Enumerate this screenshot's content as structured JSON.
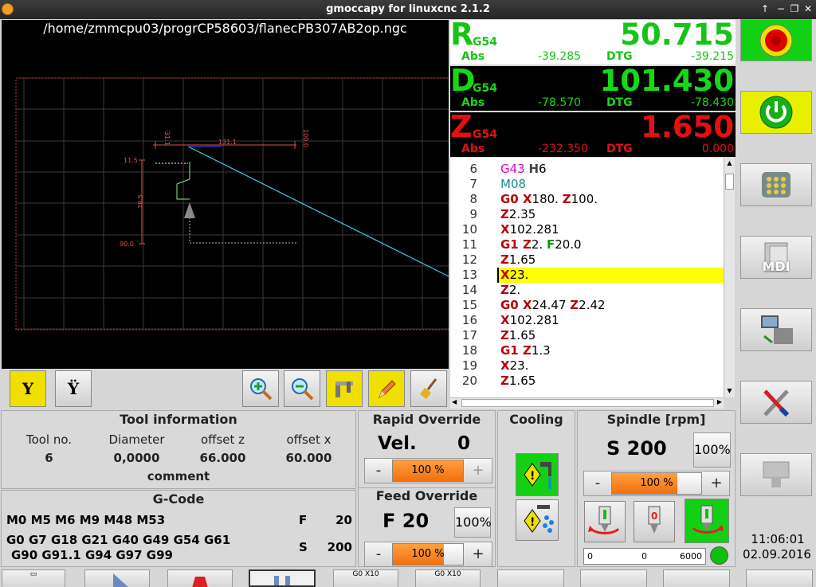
{
  "window": {
    "title": "gmoccapy for linuxcnc  2.1.2"
  },
  "preview": {
    "path": "/home/zmmcpu03/progrCP58603/flanecPB307AB2op.ngc"
  },
  "dro": [
    {
      "axis": "R",
      "system": "G54",
      "value": "50.715",
      "abs_label": "Abs",
      "abs": "-39.285",
      "dtg_label": "DTG",
      "dtg": "-39.215",
      "bg": "#ffffff",
      "fg": "#16c416"
    },
    {
      "axis": "D",
      "system": "G54",
      "value": "101.430",
      "abs_label": "Abs",
      "abs": "-78.570",
      "dtg_label": "DTG",
      "dtg": "-78.430",
      "bg": "#000000",
      "fg": "#16d816"
    },
    {
      "axis": "Z",
      "system": "G54",
      "value": "1.650",
      "abs_label": "Abs",
      "abs": "-232.350",
      "dtg_label": "DTG",
      "dtg": "0.000",
      "bg": "#000000",
      "fg": "#e41010"
    }
  ],
  "gcode": {
    "lines": [
      {
        "n": "6",
        "code": [
          [
            "g43",
            "G43 "
          ],
          [
            "hv",
            "H"
          ],
          [
            "plain",
            "6"
          ]
        ]
      },
      {
        "n": "7",
        "code": [
          [
            "m",
            "M08"
          ]
        ]
      },
      {
        "n": "8",
        "code": [
          [
            "w",
            "G0 X"
          ],
          [
            "plain",
            "180. "
          ],
          [
            "w",
            "Z"
          ],
          [
            "plain",
            "100."
          ]
        ]
      },
      {
        "n": "9",
        "code": [
          [
            "w",
            "Z"
          ],
          [
            "plain",
            "2.35"
          ]
        ]
      },
      {
        "n": "10",
        "code": [
          [
            "w",
            "X"
          ],
          [
            "plain",
            "102.281"
          ]
        ]
      },
      {
        "n": "11",
        "code": [
          [
            "w",
            "G1 Z"
          ],
          [
            "plain",
            "2. "
          ],
          [
            "f",
            "F"
          ],
          [
            "plain",
            "20.0"
          ]
        ]
      },
      {
        "n": "12",
        "code": [
          [
            "w",
            "Z"
          ],
          [
            "plain",
            "1.65"
          ]
        ]
      },
      {
        "n": "13",
        "code": [
          [
            "w",
            "X"
          ],
          [
            "plain",
            "23."
          ]
        ],
        "current": true
      },
      {
        "n": "14",
        "code": [
          [
            "w",
            "Z"
          ],
          [
            "plain",
            "2."
          ]
        ]
      },
      {
        "n": "15",
        "code": [
          [
            "w",
            "G0 X"
          ],
          [
            "plain",
            "24.47 "
          ],
          [
            "w",
            "Z"
          ],
          [
            "plain",
            "2.42"
          ]
        ]
      },
      {
        "n": "16",
        "code": [
          [
            "w",
            "X"
          ],
          [
            "plain",
            "102.281"
          ]
        ]
      },
      {
        "n": "17",
        "code": [
          [
            "w",
            "Z"
          ],
          [
            "plain",
            "1.65"
          ]
        ]
      },
      {
        "n": "18",
        "code": [
          [
            "w",
            "G1 Z"
          ],
          [
            "plain",
            "1.3"
          ]
        ]
      },
      {
        "n": "19",
        "code": [
          [
            "w",
            "X"
          ],
          [
            "plain",
            "23."
          ]
        ]
      },
      {
        "n": "20",
        "code": [
          [
            "w",
            "Z"
          ],
          [
            "plain",
            "1.65"
          ]
        ]
      }
    ]
  },
  "tool_info": {
    "title": "Tool information",
    "headers": [
      "Tool no.",
      "Diameter",
      "offset z",
      "offset x"
    ],
    "values": [
      "6",
      "0,0000",
      "66.000",
      "60.000"
    ],
    "comment_label": "comment"
  },
  "gcode_info": {
    "title": "G-Code",
    "mcodes": "M0 M5 M6 M9 M48 M53",
    "gcodes_1": "G0 G7 G18 G21 G40 G49 G54 G61",
    "gcodes_2": "G90 G91.1 G94 G97 G99",
    "f_label": "F",
    "f_value": "20",
    "s_label": "S",
    "s_value": "200"
  },
  "rapid": {
    "title": "Rapid Override",
    "vel_label": "Vel.",
    "vel_value": "0",
    "minus": "-",
    "plus": "+",
    "percent": "100 %",
    "level": 1.0
  },
  "feed": {
    "title": "Feed Override",
    "label": "F  20",
    "pct_button": "100%",
    "minus": "-",
    "plus": "+",
    "percent": "100 %",
    "level": 0.73
  },
  "cooling": {
    "title": "Cooling"
  },
  "spindle": {
    "title": "Spindle [rpm]",
    "speed": "S 200",
    "pct_button": "100%",
    "minus": "-",
    "plus": "+",
    "percent": "100 %",
    "level": 0.73,
    "bar_min": "0",
    "bar_value": "0",
    "bar_max": "6000",
    "status_color": "#10c010"
  },
  "clock": {
    "time": "11:06:01",
    "date": "02.09.2016"
  },
  "sidebar": {
    "mdi_label": "MDI"
  },
  "bottom": {
    "b1": "G0 X10",
    "b2": "G0 X10"
  },
  "colors": {
    "active": "#f0e000",
    "estop": "#e00000",
    "power": "#e8f000"
  }
}
